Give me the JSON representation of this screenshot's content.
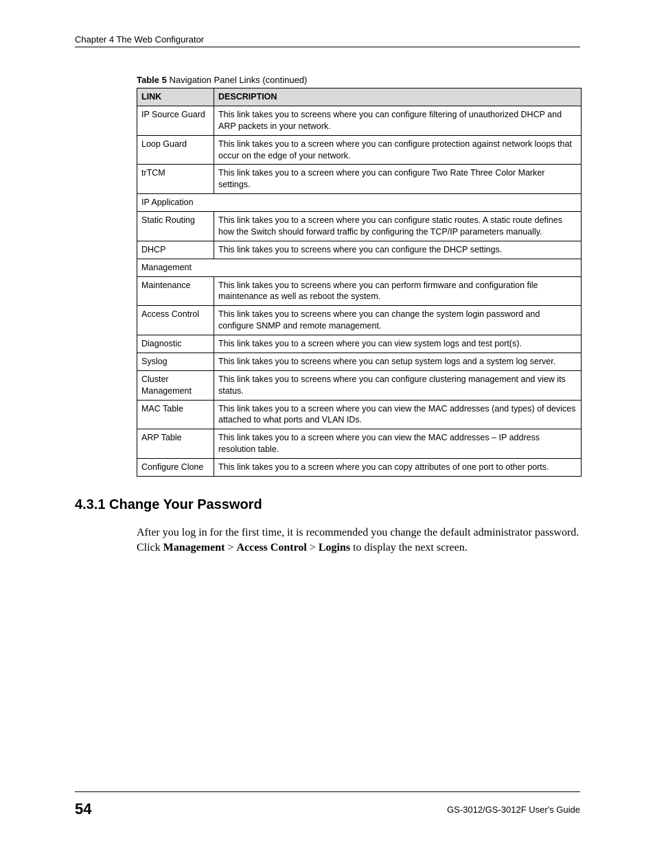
{
  "header": {
    "chapter": "Chapter 4 The Web Configurator"
  },
  "table": {
    "caption_bold": "Table 5",
    "caption_rest": "   Navigation Panel Links  (continued)",
    "headers": {
      "link": "LINK",
      "description": "DESCRIPTION"
    },
    "rows": [
      {
        "link": "IP Source Guard",
        "desc": "This link takes you to screens where you can configure filtering of unauthorized DHCP and ARP packets in your network."
      },
      {
        "link": "Loop Guard",
        "desc": "This link takes you to a screen where you can configure protection against network loops that occur on the edge of your network."
      },
      {
        "link": "trTCM",
        "desc": "This link takes you to a screen where you can configure  Two Rate Three Color Marker settings."
      },
      {
        "link": "IP Application",
        "desc": "",
        "span": true
      },
      {
        "link": "Static Routing",
        "desc": "This link takes you to a screen where you can configure static routes. A static route defines how the Switch should forward traffic by configuring the TCP/IP parameters manually."
      },
      {
        "link": "DHCP",
        "desc": "This link takes you to screens where you can configure the DHCP settings."
      },
      {
        "link": "Management",
        "desc": "",
        "span": true
      },
      {
        "link": "Maintenance",
        "desc": "This link takes you to screens where you can perform firmware and configuration file maintenance as well as reboot the system."
      },
      {
        "link": "Access Control",
        "desc": "This link takes you to screens where you can change the system login password and configure SNMP and remote management."
      },
      {
        "link": "Diagnostic",
        "desc": "This link takes you to a screen where you can view system logs and test port(s)."
      },
      {
        "link": "Syslog",
        "desc": "This link takes you to screens where you can setup system logs and a system log server."
      },
      {
        "link": "Cluster Management",
        "desc": "This link takes you to screens where you can configure clustering management and view its status."
      },
      {
        "link": "MAC Table",
        "desc": "This link takes you to a screen where you can view the MAC addresses (and types) of devices attached to what ports and VLAN IDs."
      },
      {
        "link": "ARP Table",
        "desc": "This link takes you to a screen where you can view the MAC addresses – IP address resolution table."
      },
      {
        "link": "Configure Clone",
        "desc": "This link takes you to a screen where you can copy attributes of one port to other ports."
      }
    ]
  },
  "section": {
    "heading": "4.3.1  Change Your Password",
    "para_before": "After you log in for the first time, it is recommended you change the default administrator password. Click  ",
    "bold1": "Management",
    "sep1": " > ",
    "bold2": "Access Control",
    "sep2": " > ",
    "bold3": "Logins",
    "para_after": " to display the next screen."
  },
  "footer": {
    "page": "54",
    "guide": "GS-3012/GS-3012F User's Guide"
  }
}
